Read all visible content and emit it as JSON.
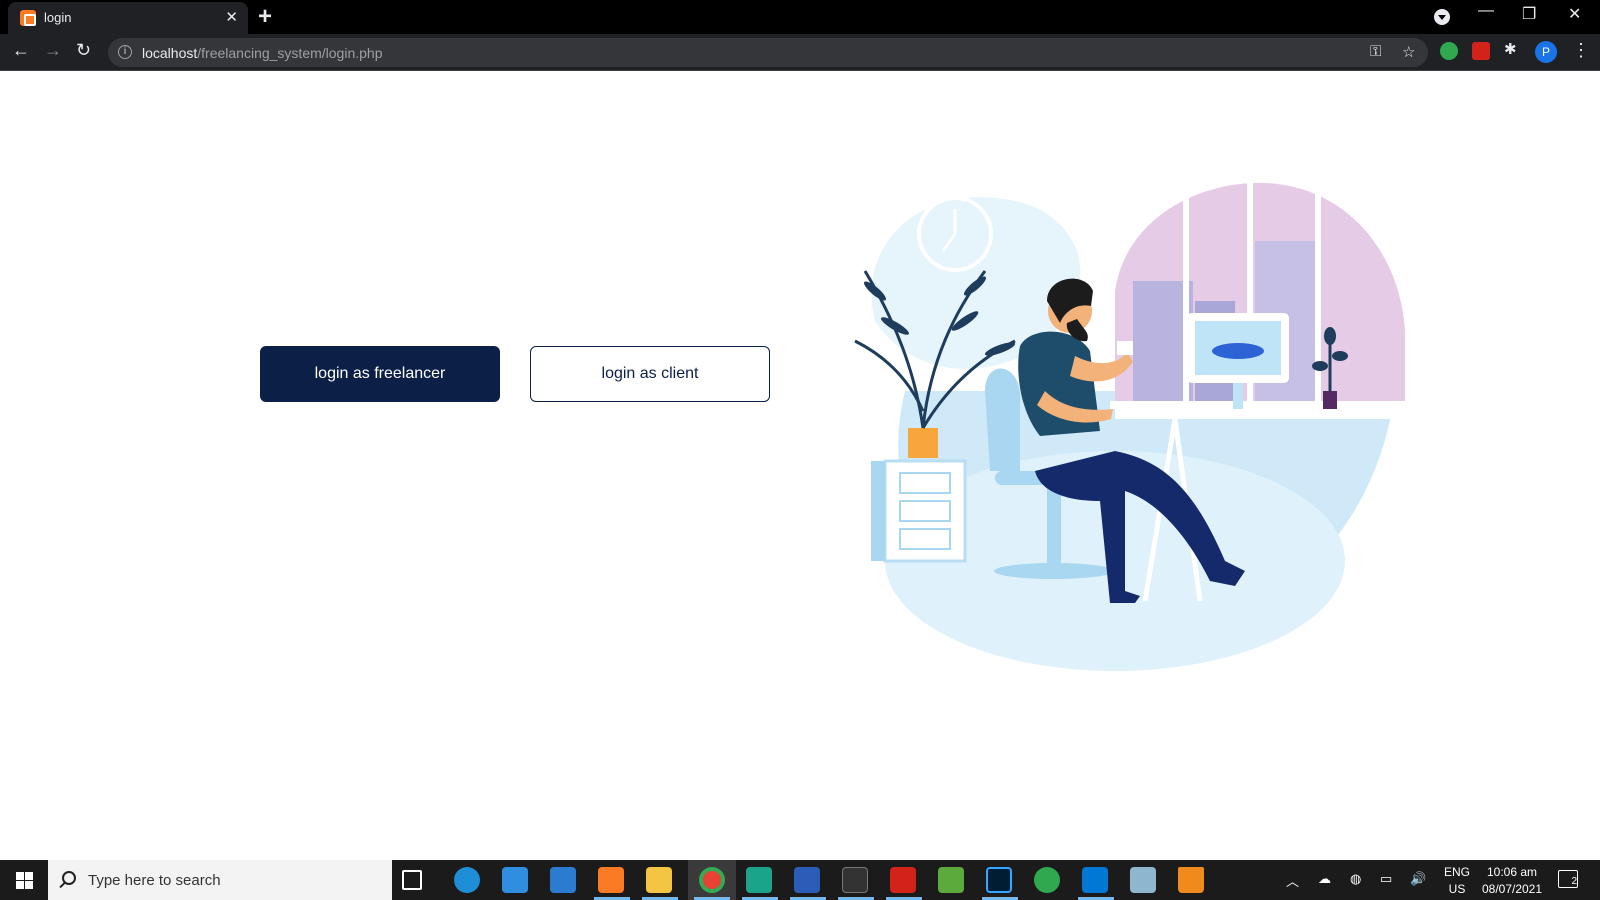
{
  "browser": {
    "tab_title": "login",
    "url_host": "localhost",
    "url_path": "/freelancing_system/login.php",
    "avatar_initial": "P"
  },
  "page": {
    "freelancer_button_label": "login as freelancer",
    "client_button_label": "login as client",
    "illustration": "person-working-at-desk-illustration"
  },
  "taskbar": {
    "search_placeholder": "Type here to search",
    "language_line1": "ENG",
    "language_line2": "US",
    "time": "10:06 am",
    "date": "08/07/2021",
    "notification_count": "2"
  },
  "colors": {
    "primary_navy": "#0b1f47",
    "chrome_dark": "#202124",
    "taskbar": "#1b1b1b",
    "illustration_blue": "#cfe9f8"
  }
}
